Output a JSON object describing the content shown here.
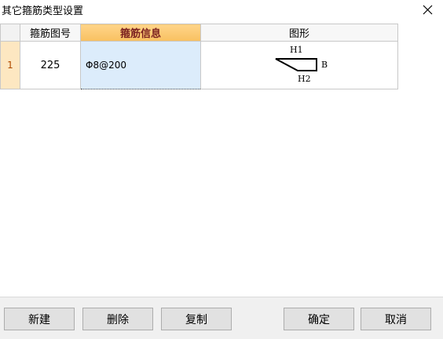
{
  "window": {
    "title": "其它箍筋类型设置",
    "close_icon": "close-icon"
  },
  "table": {
    "headers": [
      "",
      "箍筋图号",
      "箍筋信息",
      "图形"
    ],
    "rows": [
      {
        "row_number": "1",
        "figure_no": "225",
        "rebar_symbol": "Φ",
        "rebar_spec": "8@200",
        "shape": {
          "label_top": "H1",
          "label_right": "B",
          "label_bottom": "H2"
        }
      }
    ]
  },
  "buttons": {
    "new": "新建",
    "delete": "删除",
    "copy": "复制",
    "ok": "确定",
    "cancel": "取消"
  },
  "colors": {
    "active_header": "#f8c060",
    "row_header": "#fde7c1",
    "selected_cell": "#dcecfb"
  }
}
